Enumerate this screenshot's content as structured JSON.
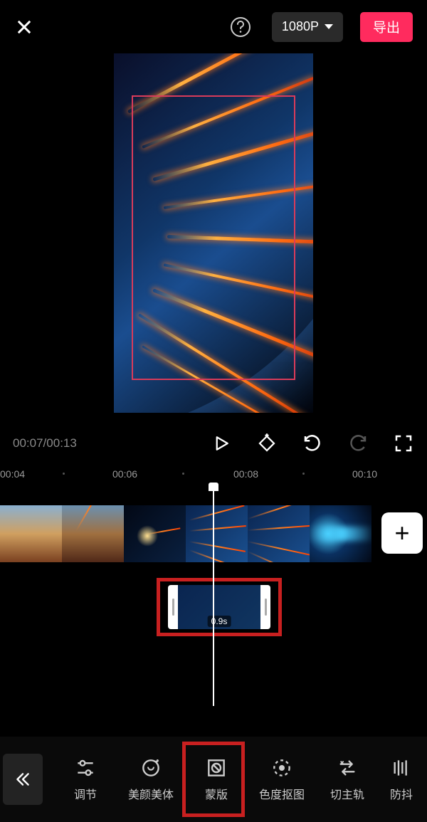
{
  "topbar": {
    "resolution": "1080P",
    "export_label": "导出"
  },
  "playback": {
    "current": "00:07",
    "total": "00:13"
  },
  "ruler": {
    "ticks": [
      "00:04",
      "00:06",
      "00:08",
      "00:10"
    ]
  },
  "clip": {
    "duration_label": "0.9s"
  },
  "tools": [
    {
      "label": "调节",
      "icon": "adjust"
    },
    {
      "label": "美颜美体",
      "icon": "beauty"
    },
    {
      "label": "蒙版",
      "icon": "mask"
    },
    {
      "label": "色度抠图",
      "icon": "chroma"
    },
    {
      "label": "切主轨",
      "icon": "switch-track"
    },
    {
      "label": "防抖",
      "icon": "stabilize"
    }
  ]
}
